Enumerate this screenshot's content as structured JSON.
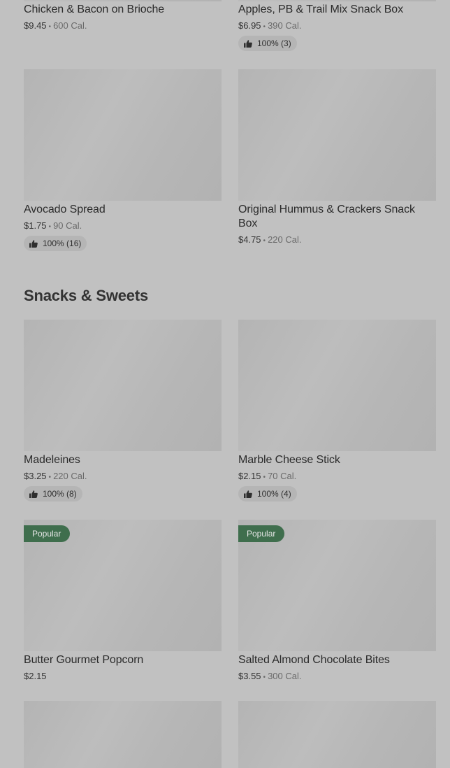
{
  "sections": {
    "snacks_title": "Snacks & Sweets"
  },
  "items": {
    "chicken_bacon": {
      "name": "Chicken & Bacon on Brioche",
      "price": "$9.45",
      "cal": "600 Cal."
    },
    "apples_pb": {
      "name": "Apples, PB & Trail Mix Snack Box",
      "price": "$6.95",
      "cal": "390 Cal.",
      "rating": "100% (3)"
    },
    "avocado": {
      "name": "Avocado Spread",
      "price": "$1.75",
      "cal": "90 Cal.",
      "rating": "100% (16)"
    },
    "hummus": {
      "name": "Original Hummus & Crackers Snack Box",
      "price": "$4.75",
      "cal": "220 Cal."
    },
    "madeleines": {
      "name": "Madeleines",
      "price": "$3.25",
      "cal": "220 Cal.",
      "rating": "100% (8)"
    },
    "marble_cheese": {
      "name": "Marble Cheese Stick",
      "price": "$2.15",
      "cal": "70 Cal.",
      "rating": "100% (4)"
    },
    "popcorn": {
      "name": "Butter Gourmet Popcorn",
      "price": "$2.15",
      "badge": "Popular"
    },
    "almond": {
      "name": "Salted Almond Chocolate Bites",
      "price": "$3.55",
      "cal": "300 Cal.",
      "badge": "Popular"
    }
  },
  "icons": {
    "rating": "thumbs-up-icon"
  },
  "colors": {
    "popular_badge": "#3f6e4d",
    "overlay": "#c1c1c1"
  }
}
